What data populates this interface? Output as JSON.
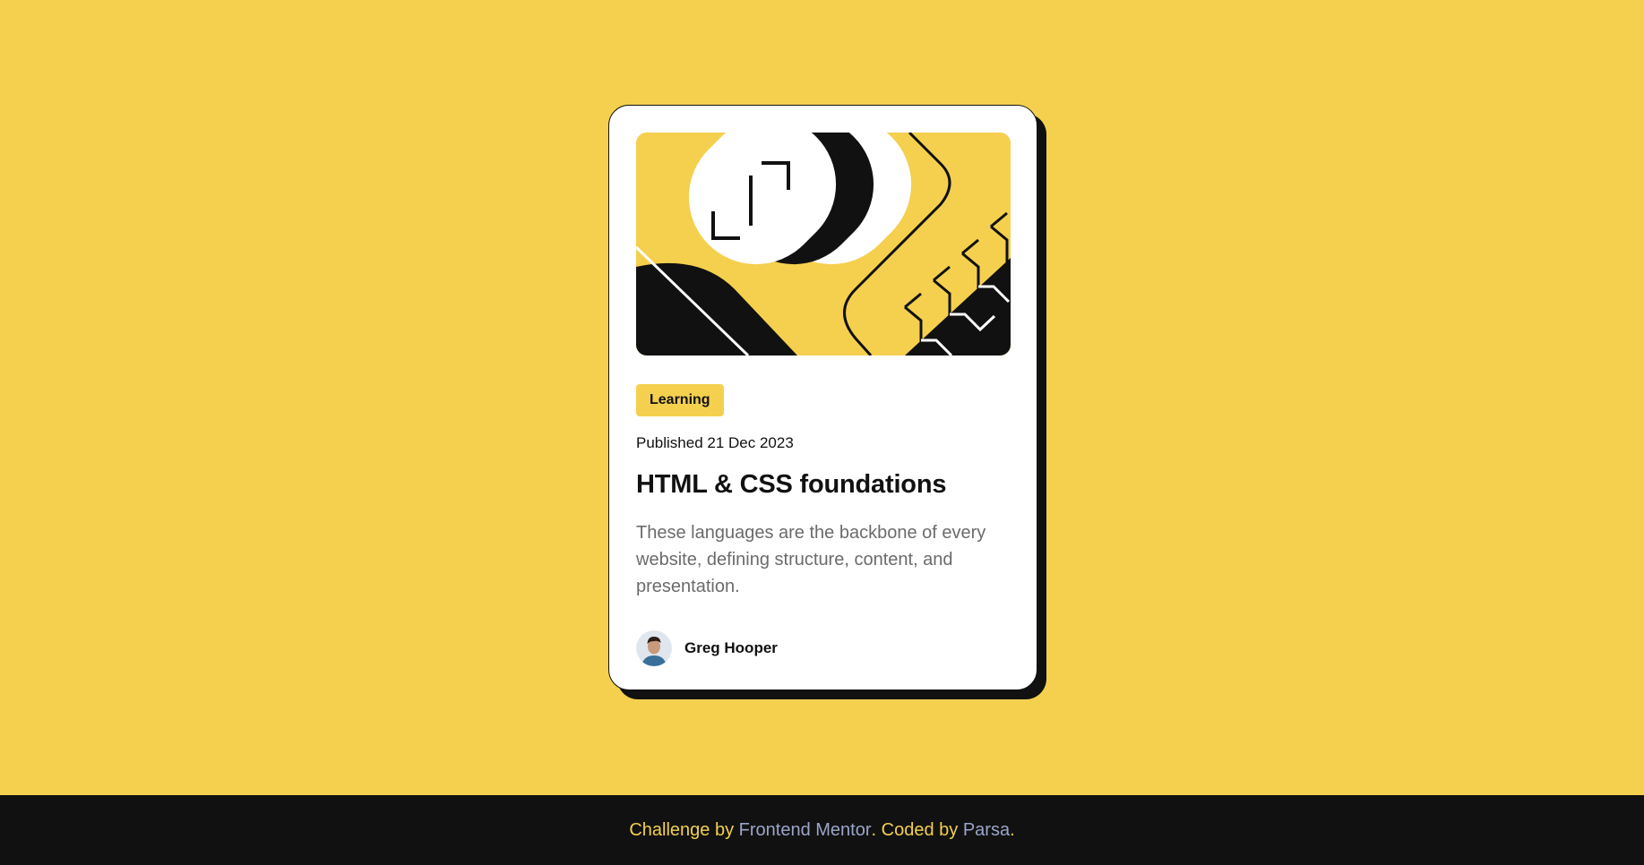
{
  "card": {
    "tag": "Learning",
    "published": "Published 21 Dec 2023",
    "title": "HTML & CSS foundations",
    "description": "These languages are the backbone of every website, defining structure, content, and presentation.",
    "author": "Greg Hooper",
    "hero_icon": "abstract-illustration",
    "avatar_icon": "user-avatar"
  },
  "footer": {
    "challenge_by": "Challenge by",
    "frontend_mentor": "Frontend Mentor",
    "sep1": ".",
    "coded_by": "Coded by",
    "author_link": "Parsa",
    "sep2": "."
  },
  "colors": {
    "background": "#f4d04e",
    "card": "#ffffff",
    "dark": "#111111",
    "muted_text": "#6b6b6b",
    "link": "#9aa5c9"
  }
}
